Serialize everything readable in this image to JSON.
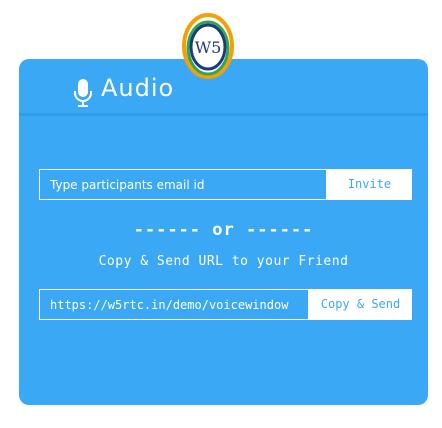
{
  "logo": {
    "text": "W5",
    "icon": "w5rtc-logo"
  },
  "sidebar": {
    "icon": "sliders-icon"
  },
  "header": {
    "title": "Audio",
    "icon": "microphone-icon"
  },
  "invite": {
    "placeholder": "Type participants email id",
    "button_label": "Invite"
  },
  "divider": {
    "text": "------ or ------"
  },
  "share": {
    "caption": "Copy & Send URL to your Friend",
    "url": "https://w5rtc.in/demo/voicewindow",
    "button_label": "Copy & Send"
  },
  "colors": {
    "accent": "#3aa8f4",
    "text": "#ffffff",
    "logo_ring": "#f5a000",
    "logo_ring2": "#2ea65a"
  }
}
